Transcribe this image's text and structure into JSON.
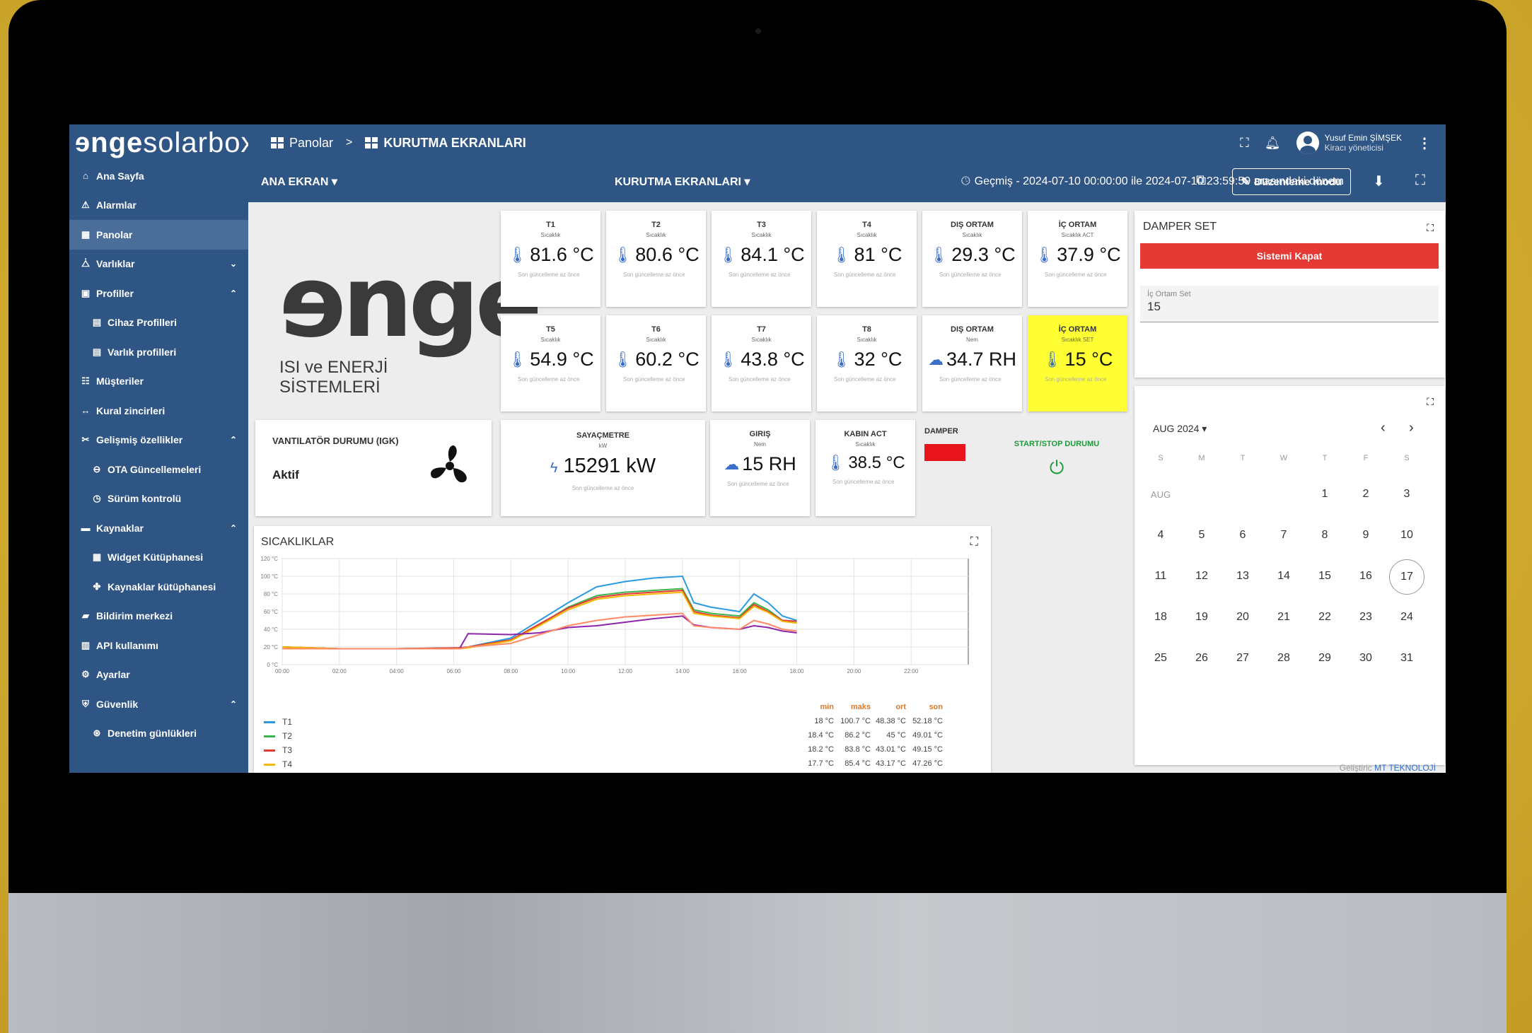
{
  "brand": {
    "logo_bold": "nge",
    "logo_light": "solarbox",
    "company_mark": "nge",
    "company_sub": "ISI ve ENERJİ SİSTEMLERİ"
  },
  "sidebar": {
    "items": [
      {
        "label": "Ana Sayfa",
        "icon": "home-icon"
      },
      {
        "label": "Alarmlar",
        "icon": "warning-icon"
      },
      {
        "label": "Panolar",
        "icon": "dashboard-icon"
      },
      {
        "label": "Varlıklar",
        "icon": "assets-icon"
      },
      {
        "label": "Profiller",
        "icon": "briefcase-icon"
      },
      {
        "label": "Cihaz Profilleri",
        "icon": "device-profile-icon"
      },
      {
        "label": "Varlık profilleri",
        "icon": "asset-profile-icon"
      },
      {
        "label": "Müşteriler",
        "icon": "customers-icon"
      },
      {
        "label": "Kural zincirleri",
        "icon": "rule-chain-icon"
      },
      {
        "label": "Gelişmiş özellikler",
        "icon": "tools-icon"
      },
      {
        "label": "OTA Güncellemeleri",
        "icon": "ota-icon"
      },
      {
        "label": "Sürüm kontrolü",
        "icon": "version-icon"
      },
      {
        "label": "Kaynaklar",
        "icon": "folder-icon"
      },
      {
        "label": "Widget Kütüphanesi",
        "icon": "widget-icon"
      },
      {
        "label": "Kaynaklar kütüphanesi",
        "icon": "resource-icon"
      },
      {
        "label": "Bildirim merkezi",
        "icon": "notification-icon"
      },
      {
        "label": "API kullanımı",
        "icon": "api-icon"
      },
      {
        "label": "Ayarlar",
        "icon": "settings-icon"
      },
      {
        "label": "Güvenlik",
        "icon": "security-icon"
      },
      {
        "label": "Denetim günlükleri",
        "icon": "audit-icon"
      }
    ]
  },
  "topbar": {
    "crumb1": "Panolar",
    "sep": ">",
    "crumb2": "KURUTMA EKRANLARI",
    "user_name": "Yusuf Emin ŞİMŞEK",
    "user_role": "Kiracı yöneticisi"
  },
  "toolbar": {
    "state": "ANA EKRAN ▾",
    "dashboard": "KURUTMA EKRANLARI ▾",
    "history": "Geçmiş - 2024-07-10 00:00:00 ile 2024-07-10 23:59:59 arasındaki dönem",
    "edit_label": "Düzenleme modu"
  },
  "tiles": [
    {
      "title": "T1",
      "sub": "Sıcaklık",
      "value": "81.6 °C",
      "icon": "thermometer-icon"
    },
    {
      "title": "T2",
      "sub": "Sıcaklık",
      "value": "80.6 °C",
      "icon": "thermometer-icon"
    },
    {
      "title": "T3",
      "sub": "Sıcaklık",
      "value": "84.1 °C",
      "icon": "thermometer-icon"
    },
    {
      "title": "T4",
      "sub": "Sıcaklık",
      "value": "81 °C",
      "icon": "thermometer-icon"
    },
    {
      "title": "DIŞ ORTAM",
      "sub": "Sıcaklık",
      "value": "29.3 °C",
      "icon": "thermometer-icon"
    },
    {
      "title": "İÇ ORTAM",
      "sub": "Sıcaklık ACT",
      "value": "37.9 °C",
      "icon": "thermometer-icon"
    },
    {
      "title": "T5",
      "sub": "Sıcaklık",
      "value": "54.9 °C",
      "icon": "thermometer-icon"
    },
    {
      "title": "T6",
      "sub": "Sıcaklık",
      "value": "60.2 °C",
      "icon": "thermometer-icon"
    },
    {
      "title": "T7",
      "sub": "Sıcaklık",
      "value": "43.8 °C",
      "icon": "thermometer-icon"
    },
    {
      "title": "T8",
      "sub": "Sıcaklık",
      "value": "32 °C",
      "icon": "thermometer-icon"
    },
    {
      "title": "DIŞ ORTAM",
      "sub": "Nem",
      "value": "34.7 RH",
      "icon": "cloud-icon"
    },
    {
      "title": "İÇ ORTAM",
      "sub": "Sıcaklık SET",
      "value": "15 °C",
      "icon": "thermometer-icon"
    }
  ],
  "tile_footer": "Son güncelleme az önce",
  "fan": {
    "title": "VANTILATÖR DURUMU (IGK)",
    "status": "Aktif"
  },
  "meter": {
    "title": "SAYAÇMETRE",
    "sub": "kW",
    "value": "15291 kW"
  },
  "giris": {
    "title": "GIRIŞ",
    "sub": "Nem",
    "value": "15 RH"
  },
  "kabin": {
    "title": "KABIN ACT",
    "sub": "Sıcaklık",
    "value": "38.5 °C"
  },
  "damper": {
    "title": "DAMPER",
    "color": "#e8141c"
  },
  "startstop": {
    "title": "START/STOP DURUMU"
  },
  "damper_set": {
    "title": "DAMPER SET",
    "button": "Sistemi Kapat",
    "field_label": "İç Ortam Set",
    "field_value": "15"
  },
  "calendar": {
    "month": "AUG 2024 ▾",
    "weekdays": [
      "S",
      "M",
      "T",
      "W",
      "T",
      "F",
      "S"
    ],
    "month_short": "AUG",
    "weeks": [
      [
        "",
        "",
        "",
        "",
        "1",
        "2",
        "3"
      ],
      [
        "4",
        "5",
        "6",
        "7",
        "8",
        "9",
        "10"
      ],
      [
        "11",
        "12",
        "13",
        "14",
        "15",
        "16",
        "17"
      ],
      [
        "18",
        "19",
        "20",
        "21",
        "22",
        "23",
        "24"
      ],
      [
        "25",
        "26",
        "27",
        "28",
        "29",
        "30",
        "31"
      ]
    ],
    "today": "17"
  },
  "footer": {
    "prefix": "Geliştiric",
    "brand": "MT TEKNOLOJİ"
  },
  "chart_panel": {
    "title": "SICAKLIKLAR",
    "stat_headers": [
      "min",
      "maks",
      "ort",
      "son"
    ]
  },
  "chart_data": {
    "type": "line",
    "title": "SICAKLIKLAR",
    "xticks": [
      "00:00",
      "02:00",
      "04:00",
      "06:00",
      "08:00",
      "10:00",
      "12:00",
      "14:00",
      "16:00",
      "18:00",
      "20:00",
      "22:00"
    ],
    "yticks": [
      "0 °C",
      "20 °C",
      "40 °C",
      "60 °C",
      "80 °C",
      "100 °C",
      "120 °C"
    ],
    "ylim": [
      0,
      120
    ],
    "x_hours": [
      0,
      2,
      4,
      6.2,
      6.5,
      8,
      9,
      10,
      11,
      12,
      13,
      14,
      14.4,
      15,
      16,
      16.5,
      17,
      17.5,
      18
    ],
    "series": [
      {
        "name": "T1",
        "color": "#2a9be0",
        "values": [
          20,
          18,
          18,
          19,
          20,
          30,
          50,
          70,
          88,
          94,
          98,
          100,
          70,
          65,
          60,
          80,
          70,
          55,
          50
        ],
        "stats": [
          "18 °C",
          "100.7 °C",
          "48.38 °C",
          "52.18 °C"
        ]
      },
      {
        "name": "T2",
        "color": "#39b54a",
        "values": [
          20,
          18,
          18,
          19,
          20,
          28,
          45,
          65,
          78,
          82,
          84,
          86,
          62,
          58,
          55,
          70,
          62,
          50,
          49
        ],
        "stats": [
          "18.4 °C",
          "86.2 °C",
          "45 °C",
          "49.01 °C"
        ]
      },
      {
        "name": "T3",
        "color": "#e53935",
        "values": [
          20,
          18,
          18,
          19,
          20,
          28,
          46,
          64,
          76,
          80,
          82,
          84,
          60,
          56,
          53,
          68,
          60,
          50,
          49
        ],
        "stats": [
          "18.2 °C",
          "83.8 °C",
          "43.01 °C",
          "49.15 °C"
        ]
      },
      {
        "name": "T4",
        "color": "#f5b800",
        "values": [
          20,
          18,
          18,
          18,
          19,
          27,
          44,
          62,
          74,
          78,
          80,
          82,
          58,
          55,
          52,
          66,
          59,
          49,
          47
        ],
        "stats": [
          "17.7 °C",
          "85.4 °C",
          "43.17 °C",
          "47.26 °C"
        ]
      },
      {
        "name": "",
        "color": "#8e24aa",
        "values": [
          18,
          18,
          18,
          18,
          35,
          34,
          36,
          42,
          44,
          48,
          52,
          55,
          45,
          42,
          40,
          44,
          42,
          38,
          36
        ],
        "stats": []
      },
      {
        "name": "",
        "color": "#ff8a65",
        "values": [
          18,
          18,
          18,
          18,
          20,
          24,
          34,
          44,
          50,
          54,
          56,
          58,
          44,
          42,
          40,
          50,
          46,
          40,
          38
        ],
        "stats": []
      }
    ]
  }
}
